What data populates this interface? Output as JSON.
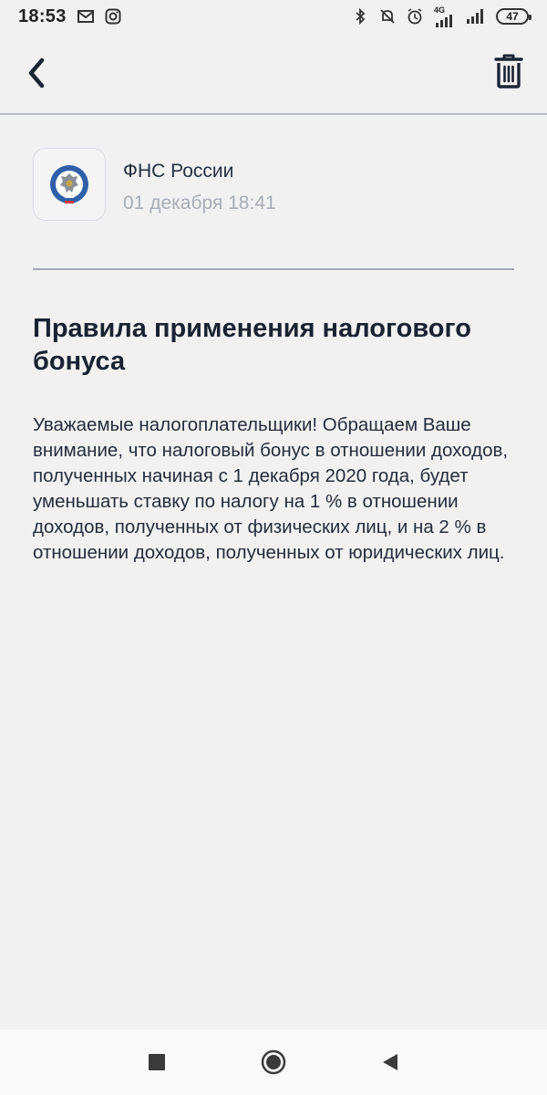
{
  "status_bar": {
    "time": "18:53",
    "network_label": "4G",
    "battery_level": "47",
    "icons": [
      "mail-icon",
      "instagram-icon",
      "bluetooth-icon",
      "mute-icon",
      "alarm-icon",
      "signal-icon",
      "signal-icon-2"
    ]
  },
  "app_bar": {
    "back_icon": "chevron-left-icon",
    "delete_icon": "trash-icon"
  },
  "message": {
    "sender_name": "ФНС России",
    "date": "01 декабря 18:41",
    "title": "Правила применения налогового бонуса",
    "body": "Уважаемые налогоплательщики! Обращаем Ваше внимание, что налоговый бонус в отношении доходов, полученных начиная с 1 декабря 2020 года, будет уменьшать ставку по налогу на 1 % в отношении доходов, полученных от физических лиц, и на 2 % в отношении доходов, полученных от юридических лиц."
  },
  "nav_bar": {
    "buttons": [
      "recent-apps-icon",
      "home-icon",
      "back-icon"
    ]
  },
  "colors": {
    "background": "#f1f1f2",
    "title": "#1a2232",
    "date": "#a9adb5",
    "divider": "#a6aab2"
  }
}
